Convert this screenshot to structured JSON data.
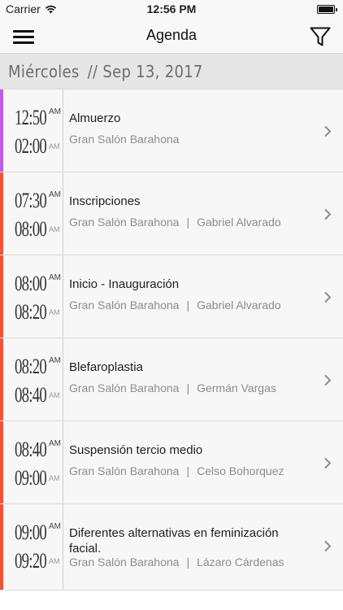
{
  "status_bar": {
    "carrier": "Carrier",
    "time": "12:56 PM"
  },
  "nav": {
    "title": "Agenda"
  },
  "day_header": {
    "day": "Miércoles",
    "separator": "//",
    "date": "Sep 13, 2017"
  },
  "sessions": [
    {
      "start": "12:50",
      "start_ampm": "AM",
      "end": "02:00",
      "end_ampm": "AM",
      "title": "Almuerzo",
      "room": "Gran Salón Barahona",
      "speaker": "",
      "accent": "#c05ce6"
    },
    {
      "start": "07:30",
      "start_ampm": "AM",
      "end": "08:00",
      "end_ampm": "AM",
      "title": "Inscripciones",
      "room": "Gran Salón Barahona",
      "speaker": "Gabriel Alvarado",
      "accent": "#f2543a"
    },
    {
      "start": "08:00",
      "start_ampm": "AM",
      "end": "08:20",
      "end_ampm": "AM",
      "title": "Inicio - Inauguración",
      "room": "Gran Salón Barahona",
      "speaker": "Gabriel Alvarado",
      "accent": "#f2543a"
    },
    {
      "start": "08:20",
      "start_ampm": "AM",
      "end": "08:40",
      "end_ampm": "AM",
      "title": "Blefaroplastia",
      "room": "Gran Salón Barahona",
      "speaker": "Germán Vargas",
      "accent": "#f2543a"
    },
    {
      "start": "08:40",
      "start_ampm": "AM",
      "end": "09:00",
      "end_ampm": "AM",
      "title": "Suspensión tercio medio",
      "room": "Gran Salón Barahona",
      "speaker": "Celso Bohorquez",
      "accent": "#f2543a"
    },
    {
      "start": "09:00",
      "start_ampm": "AM",
      "end": "09:20",
      "end_ampm": "AM",
      "title": "Diferentes alternativas en feminización facial.",
      "room": "Gran Salón Barahona",
      "speaker": "Lázaro Cárdenas",
      "accent": "#f2543a"
    }
  ],
  "colors": {
    "accent_purple": "#c05ce6",
    "accent_red": "#f2543a"
  }
}
